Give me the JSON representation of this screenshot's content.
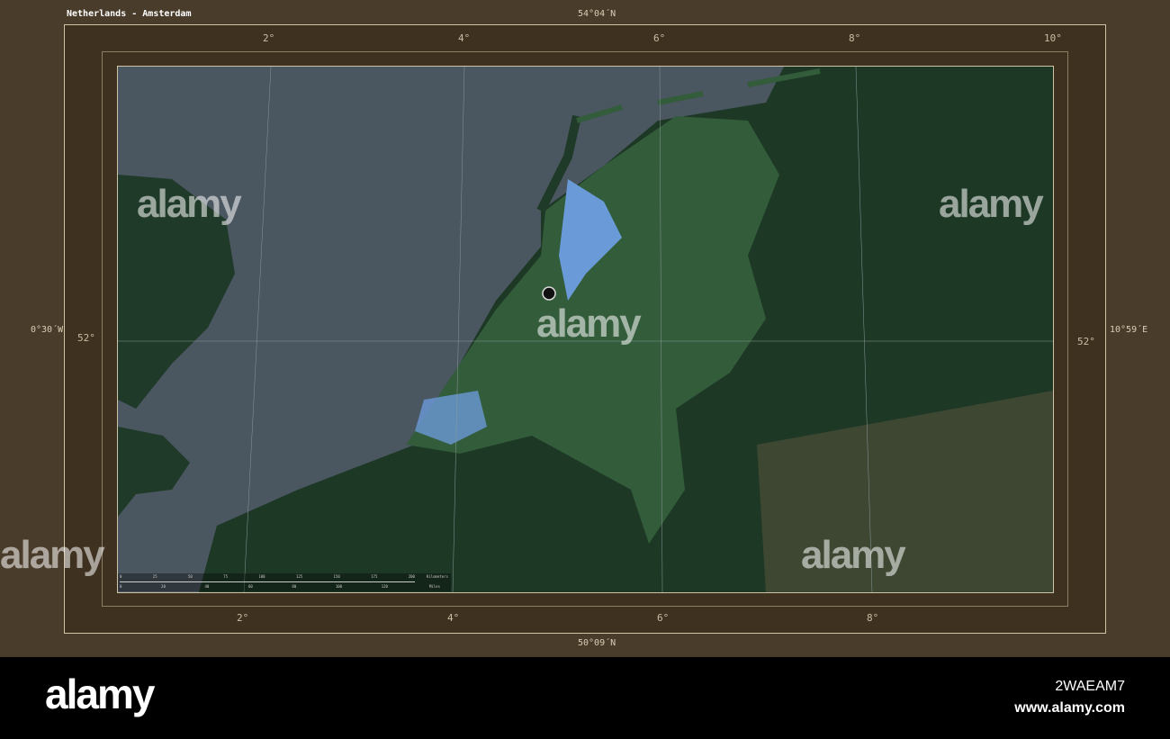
{
  "title": "Netherlands - Amsterdam",
  "frame": {
    "top": "54°04´N",
    "bottom": "50°09´N",
    "left": "0°30´W",
    "right": "10°59´E"
  },
  "lon_ticks": [
    "2°",
    "4°",
    "6°",
    "8°",
    "10°"
  ],
  "lon_ticks_bottom": [
    "2°",
    "4°",
    "6°",
    "8°"
  ],
  "lat_ticks": [
    "52°",
    "52°"
  ],
  "scale": {
    "km": [
      "0",
      "25",
      "50",
      "75",
      "100",
      "125",
      "150",
      "175",
      "200"
    ],
    "km_label": "Kilometers",
    "mi": [
      "0",
      "20",
      "40",
      "60",
      "80",
      "100",
      "120"
    ],
    "mi_label": "Miles"
  },
  "watermark": "alamy",
  "footer": {
    "logo": "alamy",
    "image_id": "2WAEAM7",
    "url": "www.alamy.com"
  },
  "colors": {
    "sea": "#4a5660",
    "land": "#1f3a28",
    "highlight": "#3d6a44",
    "water": "#6a9ad8"
  }
}
